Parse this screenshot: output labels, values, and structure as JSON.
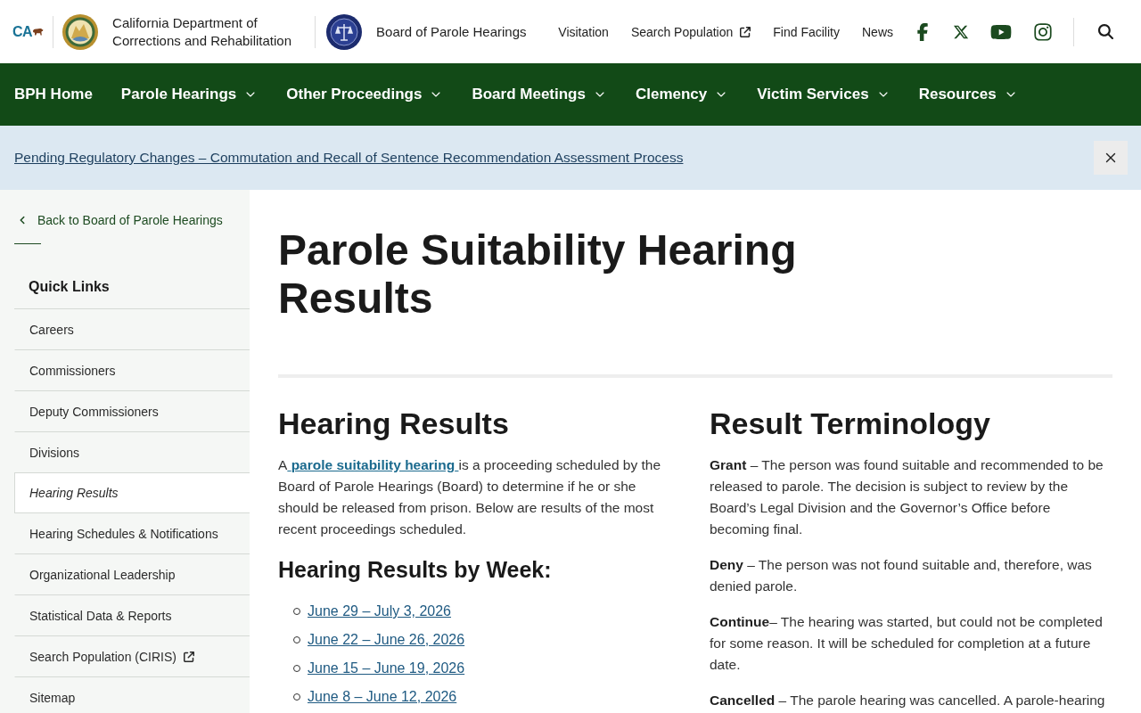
{
  "header": {
    "logo_text": "CA",
    "department_name": "California Department of Corrections and Rehabilitation",
    "board_name": "Board of Parole Hearings",
    "utility_links": [
      {
        "label": "Visitation",
        "external": false
      },
      {
        "label": "Search Population",
        "external": true
      },
      {
        "label": "Find Facility",
        "external": false
      },
      {
        "label": "News",
        "external": false
      }
    ],
    "social_links": [
      {
        "kind": "facebook"
      },
      {
        "kind": "x"
      },
      {
        "kind": "youtube"
      },
      {
        "kind": "instagram"
      }
    ]
  },
  "nav": {
    "items": [
      {
        "label": "BPH Home",
        "has_menu": false
      },
      {
        "label": "Parole Hearings",
        "has_menu": true
      },
      {
        "label": "Other Proceedings",
        "has_menu": true
      },
      {
        "label": "Board Meetings",
        "has_menu": true
      },
      {
        "label": "Clemency",
        "has_menu": true
      },
      {
        "label": "Victim Services",
        "has_menu": true
      },
      {
        "label": "Resources",
        "has_menu": true
      }
    ]
  },
  "alert": {
    "link": "Pending Regulatory Changes – Commutation and Recall of Sentence Recommendation Assessment Process"
  },
  "sidebar": {
    "back_link": "Back to Board of Parole Hearings",
    "heading": "Quick Links",
    "items": [
      {
        "label": "Careers",
        "selected": false,
        "external": false
      },
      {
        "label": "Commissioners",
        "selected": false,
        "external": false
      },
      {
        "label": "Deputy Commissioners",
        "selected": false,
        "external": false
      },
      {
        "label": "Divisions",
        "selected": false,
        "external": false
      },
      {
        "label": "Hearing Results",
        "selected": true,
        "external": false
      },
      {
        "label": "Hearing Schedules & Notifications",
        "selected": false,
        "external": false
      },
      {
        "label": "Organizational Leadership",
        "selected": false,
        "external": false
      },
      {
        "label": "Statistical Data & Reports",
        "selected": false,
        "external": false
      },
      {
        "label": "Search Population (CIRIS)",
        "selected": false,
        "external": true
      },
      {
        "label": "Sitemap",
        "selected": false,
        "external": false
      }
    ]
  },
  "main": {
    "title": "Parole Suitability Hearing Results",
    "hearing_results": {
      "heading": "Hearing Results",
      "intro": {
        "before": "A",
        "link": "parole suitability hearing",
        "after": "is a proceeding scheduled by the Board of Parole Hearings (Board) to determine if he or she should be released from prison. Below are results of the most recent proceedings scheduled."
      },
      "weeks_heading": "Hearing Results by Week:",
      "weeks": [
        "June 29 – July 3, 2026",
        "June 22 – June 26, 2026",
        "June 15 – June 19, 2026",
        "June 8 – June 12, 2026"
      ]
    },
    "terminology": {
      "heading": "Result Terminology",
      "terms": [
        "**Grant** – The person was found suitable and recommended to be released to parole. The decision is subject to review by the Board’s Legal Division and the Governor’s Office before becoming final.",
        "**Deny** – The person was not found suitable and, therefore, was denied parole.",
        "**Continue**– The hearing was started, but could not be completed for some reason. It will be scheduled for completion at a future date.",
        "**Cancelled** – The parole hearing was cancelled. A parole-hearing"
      ]
    }
  }
}
